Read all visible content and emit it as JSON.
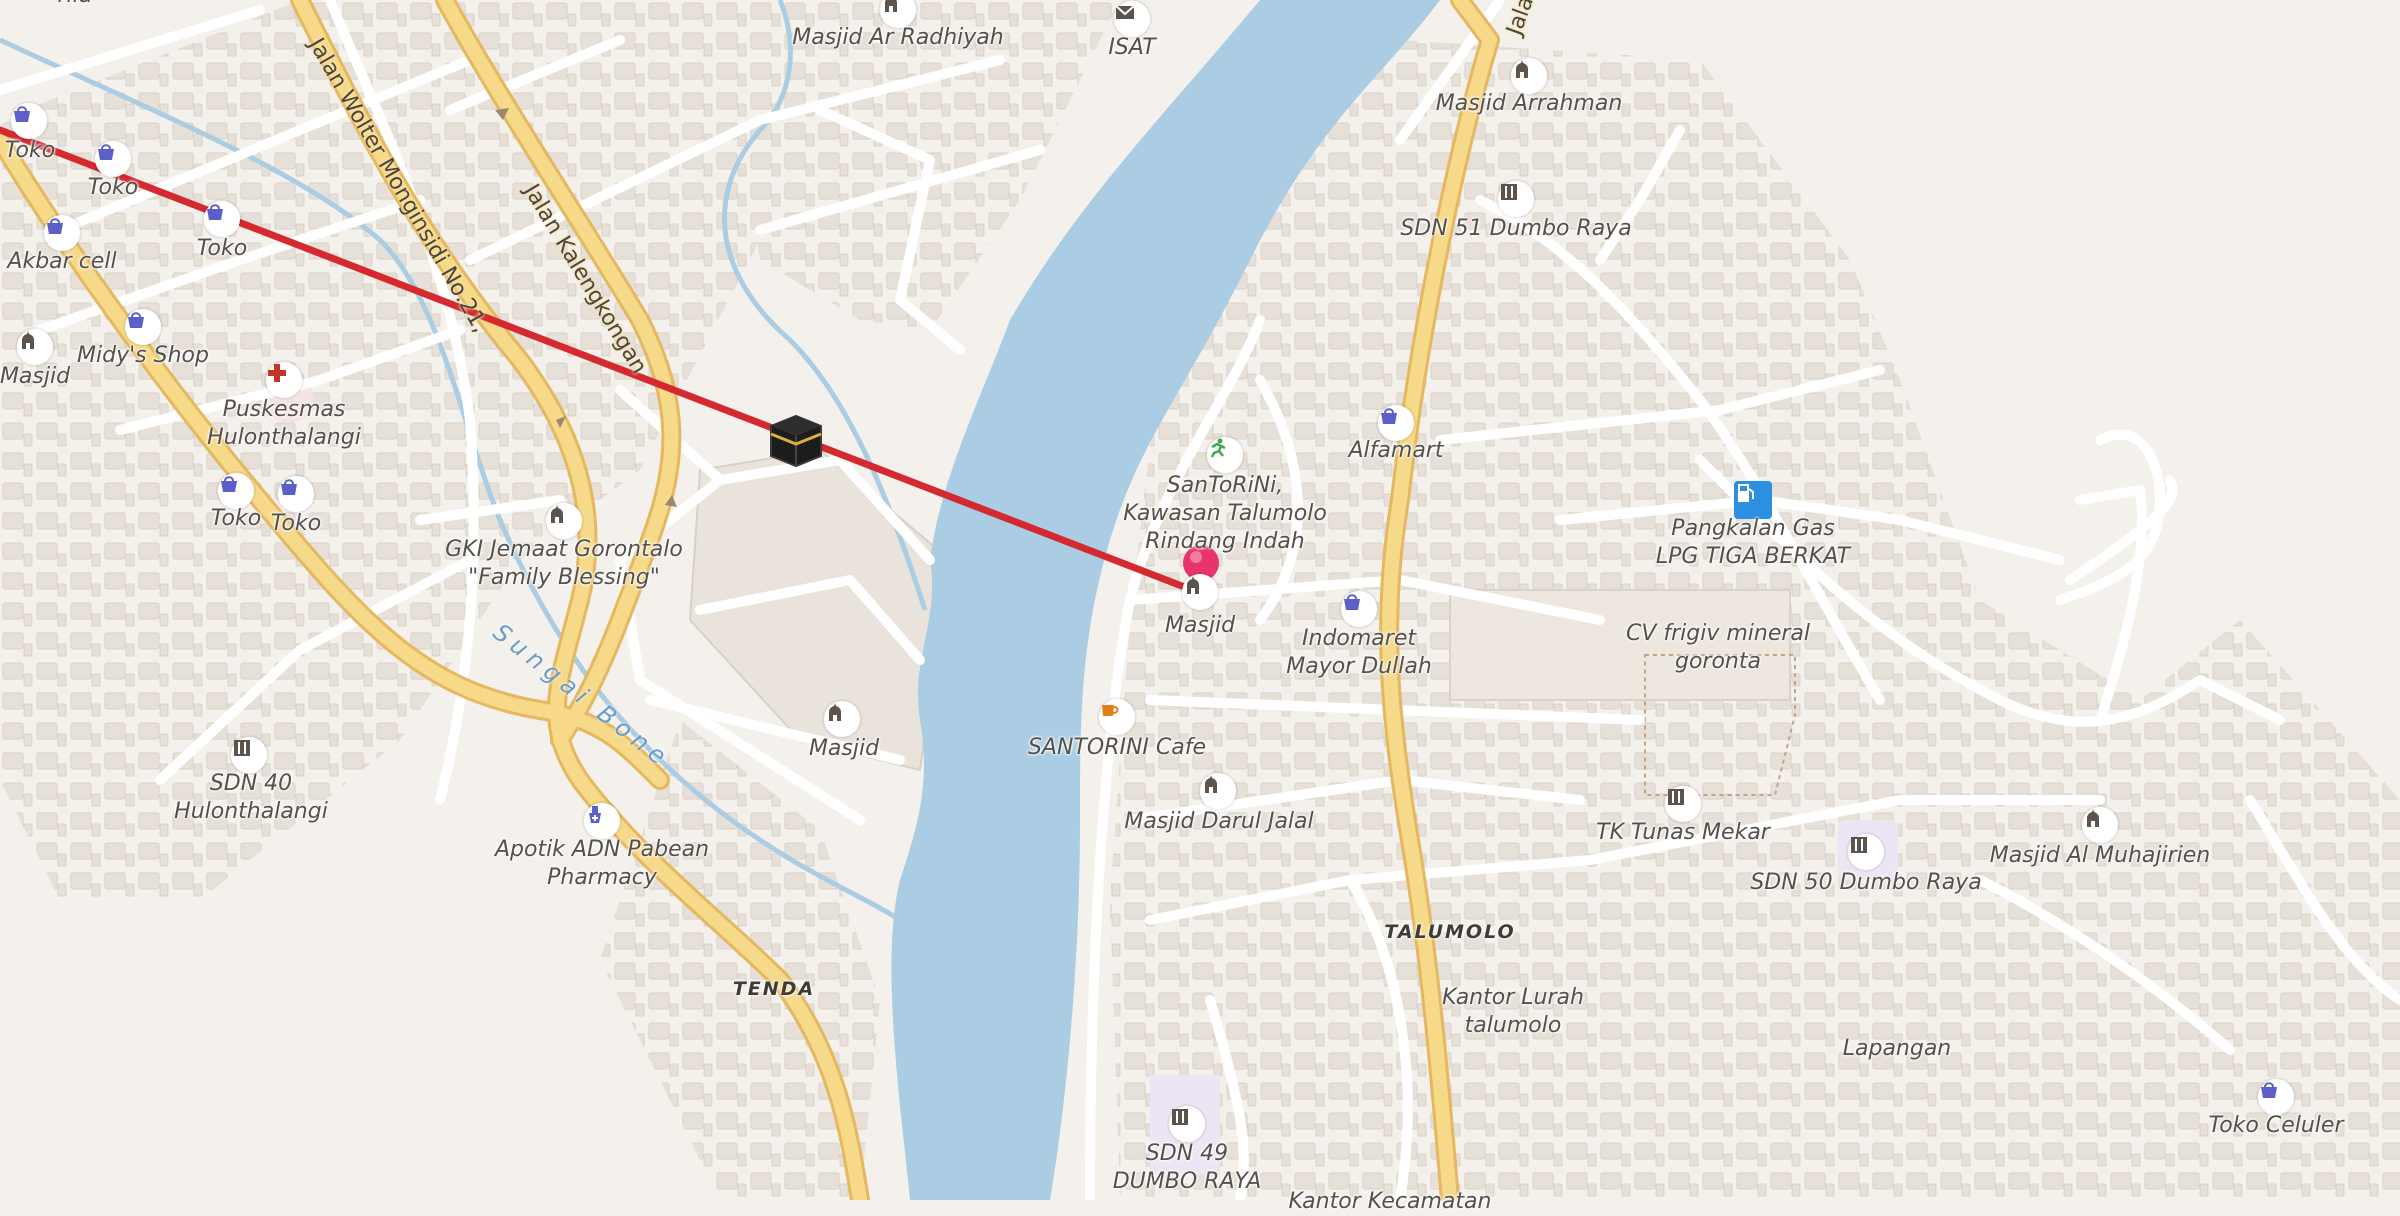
{
  "map": {
    "pois": {
      "masjid_ar_radhiyah": "Masjid Ar Radhiyah",
      "isat": "ISAT",
      "masjid_arrahman": "Masjid Arrahman",
      "sdn51": "SDN 51 Dumbo Raya",
      "toko1": "Toko",
      "toko2": "Toko",
      "toko3": "Toko",
      "akbar_cell": "Akbar cell",
      "masjid_left": "Masjid",
      "midys_shop": "Midy's Shop",
      "puskesmas": [
        "Puskesmas",
        "Hulonthalangi"
      ],
      "toko4": "Toko",
      "toko5": "Toko",
      "gki": [
        "GKI Jemaat Gorontalo",
        "\"Family Blessing\""
      ],
      "santorini": [
        "SanToRiNi,",
        "Kawasan Talumolo",
        "Rindang Indah"
      ],
      "alfamart": "Alfamart",
      "pangkalan_gas": [
        "Pangkalan Gas",
        "LPG TIGA BERKAT"
      ],
      "masjid_center": "Masjid",
      "indomaret": [
        "Indomaret",
        "Mayor Dullah"
      ],
      "cv_frigiv": [
        "CV frigiv mineral",
        "goronta"
      ],
      "masjid_mid": "Masjid",
      "santorini_cafe": "SANTORINI Cafe",
      "sdn40": [
        "SDN 40",
        "Hulonthalangi"
      ],
      "masjid_darul_jalal": "Masjid Darul Jalal",
      "tk_tunas_mekar": "TK Tunas Mekar",
      "masjid_al_muhajirien": "Masjid Al Muhajirien",
      "sdn50": "SDN 50 Dumbo Raya",
      "apotik": [
        "Apotik ADN Pabean",
        "Pharmacy"
      ],
      "kantor_lurah": [
        "Kantor Lurah",
        "talumolo"
      ],
      "lapangan": "Lapangan",
      "toko_celuler": "Toko Celuler",
      "sdn49": [
        "SDN 49",
        "DUMBO RAYA"
      ]
    },
    "areas": {
      "talumolo": "TALUMOLO",
      "tenda": "TENDA"
    },
    "roads": {
      "wolter": "Jalan Wolter Monginsidi No.21,",
      "kalengkongan": "Jalan Kalengkongan",
      "jala": "Jala"
    },
    "river": "Sungai Bone",
    "partial": {
      "top_left": "rila",
      "bottom_kantor": "Kantor Kecamatan"
    },
    "colors": {
      "background": "#f4f1ec",
      "water": "#aacde3",
      "major_road": "#f7d98a",
      "road_casing": "#e3b860",
      "minor_road": "#ffffff",
      "building": "#e6e0d8",
      "qibla_line": "#d42a2f",
      "pin": "#e8336b",
      "poi_icon": "#5c544c",
      "shop_icon": "#5b5fc7",
      "health_icon": "#c8342c",
      "fuel_icon": "#2d8fe0",
      "cafe_icon": "#e27d1a"
    },
    "icons": {
      "pin": "location-pin-icon",
      "kaaba": "kaaba-icon",
      "mosque": "mosque-icon",
      "shop": "shop-basket-icon",
      "school": "school-icon",
      "health": "health-cross-icon",
      "fuel": "fuel-station-icon",
      "cafe": "cafe-cup-icon",
      "pharmacy": "pharmacy-icon",
      "sport": "running-man-icon",
      "post": "envelope-icon"
    }
  }
}
